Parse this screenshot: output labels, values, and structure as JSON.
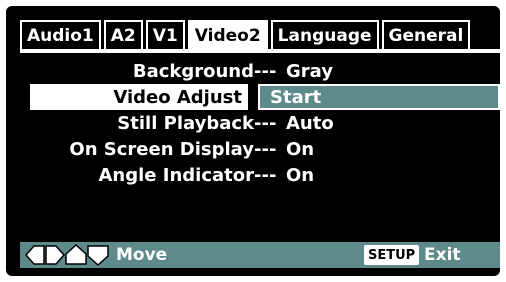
{
  "tabs": [
    {
      "label": "Audio1",
      "active": false
    },
    {
      "label": "A2",
      "active": false
    },
    {
      "label": "V1",
      "active": false
    },
    {
      "label": "Video2",
      "active": true
    },
    {
      "label": "Language",
      "active": false
    },
    {
      "label": "General",
      "active": false
    }
  ],
  "separator": "---",
  "settings": [
    {
      "label": "Background",
      "value": "Gray"
    },
    {
      "label": "Video Adjust",
      "value": "Start",
      "selected": true
    },
    {
      "label": "Still Playback",
      "value": "Auto"
    },
    {
      "label": "On Screen Display",
      "value": "On"
    },
    {
      "label": "Angle Indicator",
      "value": "On"
    }
  ],
  "statusbar": {
    "nav_icons": [
      "left-arrow-icon",
      "right-arrow-icon",
      "up-arrow-icon",
      "down-arrow-icon"
    ],
    "move_label": "Move",
    "setup_key": "SETUP",
    "exit_label": "Exit"
  },
  "colors": {
    "background": "#000000",
    "text": "#ffffff",
    "accent": "#5f8a8b",
    "highlight": "#ffffff"
  }
}
